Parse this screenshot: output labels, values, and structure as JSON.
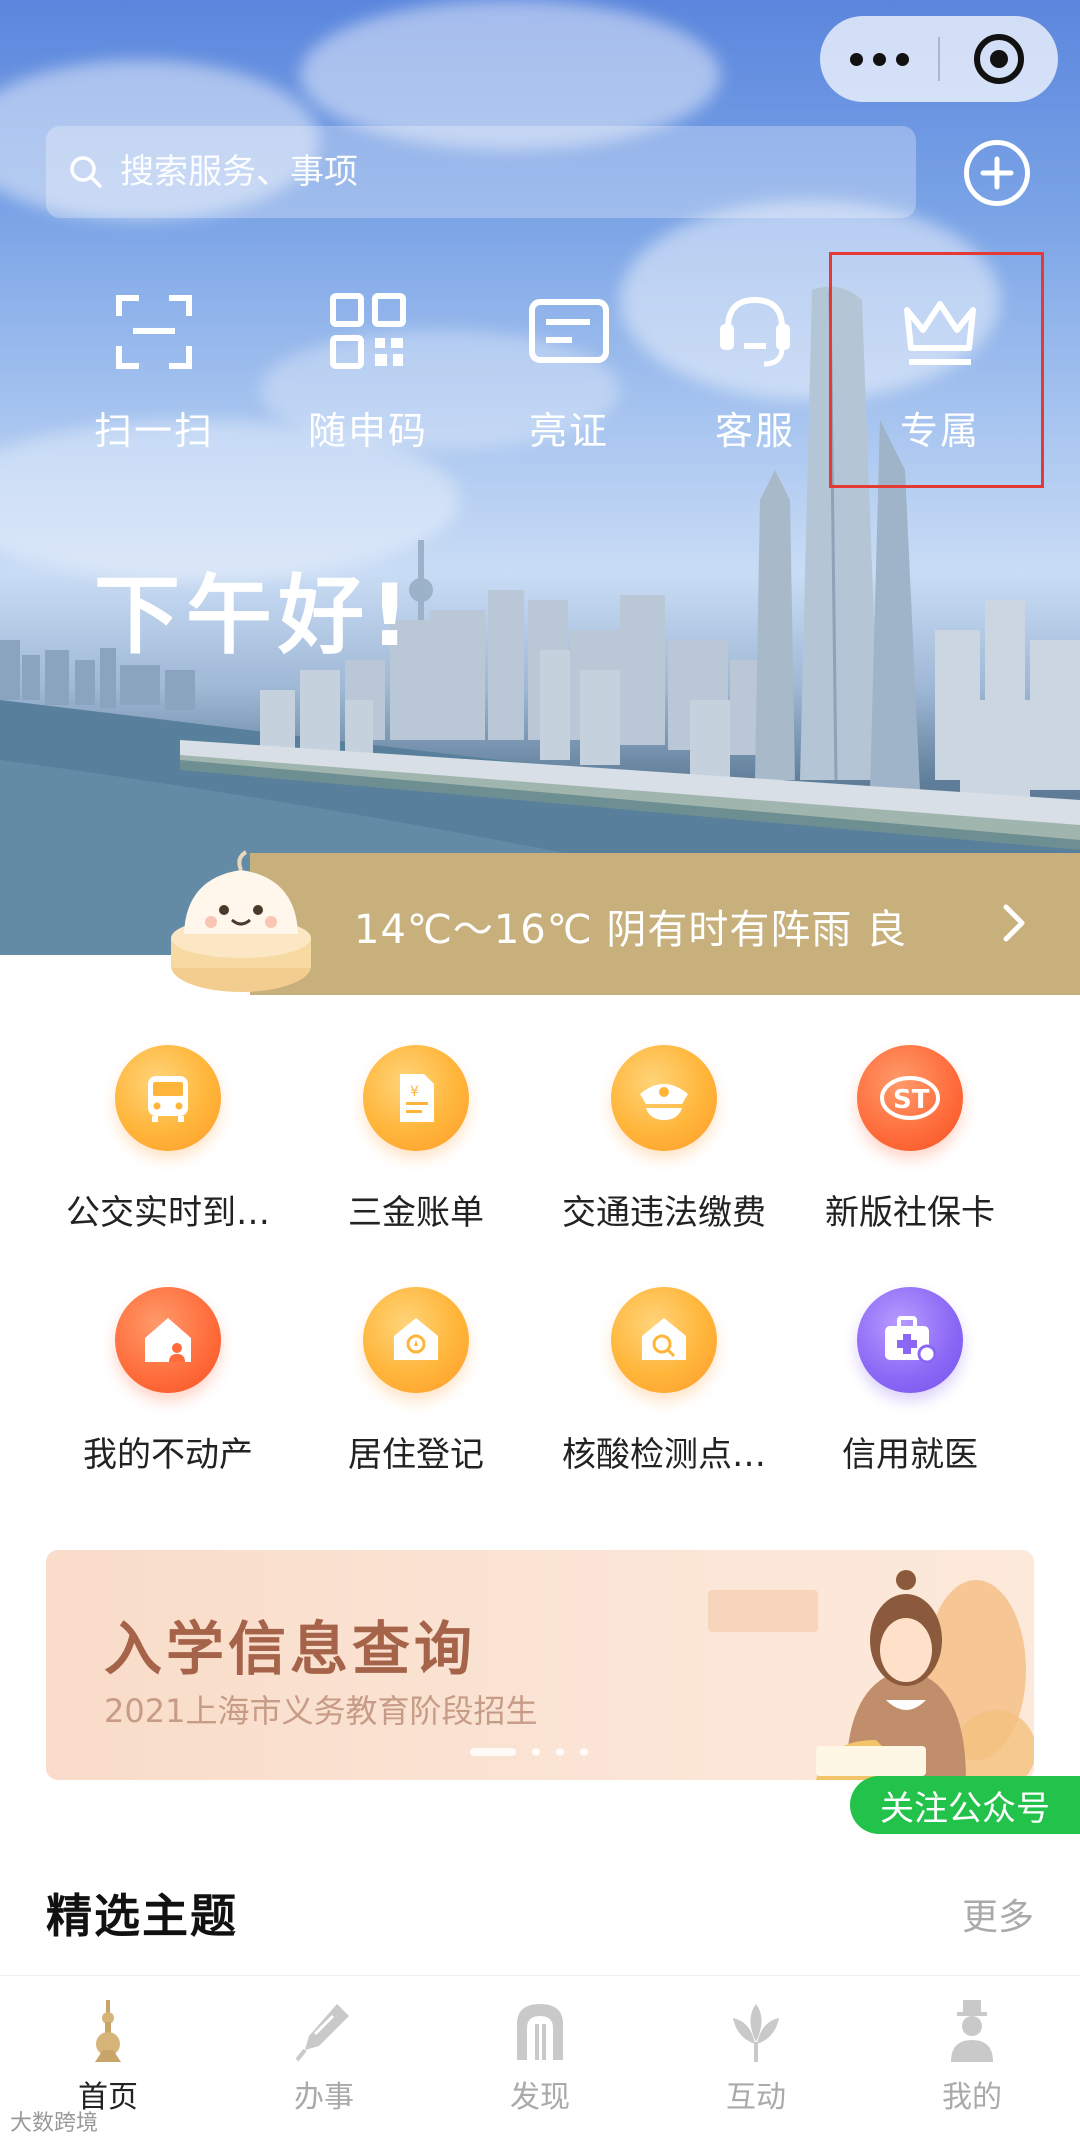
{
  "header": {
    "search_placeholder": "搜索服务、事项",
    "greeting": "下午好!"
  },
  "quick_actions": [
    {
      "label": "扫一扫",
      "icon": "scan-icon"
    },
    {
      "label": "随申码",
      "icon": "qr-code-icon"
    },
    {
      "label": "亮证",
      "icon": "id-card-icon"
    },
    {
      "label": "客服",
      "icon": "headset-icon"
    },
    {
      "label": "专属",
      "icon": "crown-icon"
    }
  ],
  "weather": {
    "text": "14℃～16℃ 阴有时有阵雨 良"
  },
  "services": [
    {
      "label": "公交实时到…",
      "icon": "bus-icon"
    },
    {
      "label": "三金账单",
      "icon": "bill-icon"
    },
    {
      "label": "交通违法缴费",
      "icon": "police-cap-icon"
    },
    {
      "label": "新版社保卡",
      "icon": "social-security-icon"
    },
    {
      "label": "我的不动产",
      "icon": "house-person-icon"
    },
    {
      "label": "居住登记",
      "icon": "house-icon"
    },
    {
      "label": "核酸检测点…",
      "icon": "test-site-icon"
    },
    {
      "label": "信用就医",
      "icon": "medical-kit-icon"
    }
  ],
  "banner": {
    "title": "入学信息查询",
    "subtitle": "2021上海市义务教育阶段招生"
  },
  "follow_label": "关注公众号",
  "section": {
    "title": "精选主题",
    "more": "更多"
  },
  "tabs": [
    {
      "label": "首页",
      "active": true
    },
    {
      "label": "办事",
      "active": false
    },
    {
      "label": "发现",
      "active": false
    },
    {
      "label": "互动",
      "active": false
    },
    {
      "label": "我的",
      "active": false
    }
  ],
  "watermark": "大数跨境",
  "colors": {
    "accent_gold": "#c8b07c",
    "highlight_box": "#e53935",
    "follow_green": "#23c24a",
    "banner_title": "#a5634a"
  }
}
